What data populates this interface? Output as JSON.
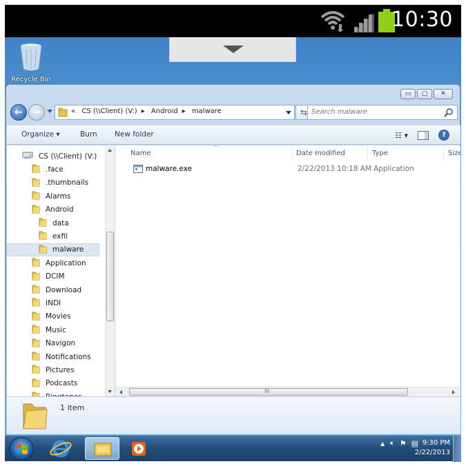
{
  "status_bar": {
    "time": "10:30"
  },
  "desktop": {
    "recycle_bin_label": "Recycle Bin"
  },
  "window": {
    "address": {
      "prefix": "«",
      "crumbs": [
        "CS (\\\\Client) (V:)",
        "Android",
        "malware"
      ]
    },
    "search": {
      "placeholder": "Search malware"
    },
    "toolbar": {
      "organize": "Organize ▾",
      "burn": "Burn",
      "new_folder": "New folder"
    },
    "nav": {
      "items": [
        {
          "label": "CS (\\\\Client) (V:)",
          "level": 0,
          "icon": "drive-icon"
        },
        {
          "label": ".face",
          "level": 1
        },
        {
          "label": ".thumbnails",
          "level": 1
        },
        {
          "label": "Alarms",
          "level": 1
        },
        {
          "label": "Android",
          "level": 1
        },
        {
          "label": "data",
          "level": 2
        },
        {
          "label": "exfil",
          "level": 2
        },
        {
          "label": "malware",
          "level": 2,
          "selected": true
        },
        {
          "label": "Application",
          "level": 1
        },
        {
          "label": "DCIM",
          "level": 1
        },
        {
          "label": "Download",
          "level": 1
        },
        {
          "label": "INDI",
          "level": 1
        },
        {
          "label": "Movies",
          "level": 1
        },
        {
          "label": "Music",
          "level": 1
        },
        {
          "label": "Navigon",
          "level": 1
        },
        {
          "label": "Notifications",
          "level": 1
        },
        {
          "label": "Pictures",
          "level": 1
        },
        {
          "label": "Podcasts",
          "level": 1
        },
        {
          "label": "Ringtones",
          "level": 1
        }
      ]
    },
    "columns": {
      "name": "Name",
      "date": "Date modified",
      "type": "Type",
      "size": "Size"
    },
    "files": [
      {
        "name": "malware.exe",
        "date": "2/22/2013 10:18 AM",
        "type": "Application"
      }
    ],
    "details": {
      "count": "1 item"
    },
    "scroll_grip": "III"
  },
  "taskbar": {
    "time": "9:30 PM",
    "date": "2/22/2013"
  },
  "colors": {
    "desktop": "#5ea2dd",
    "battery": "#8fd11a",
    "folder": "#e8c44a",
    "taskbar": "#25507e"
  }
}
